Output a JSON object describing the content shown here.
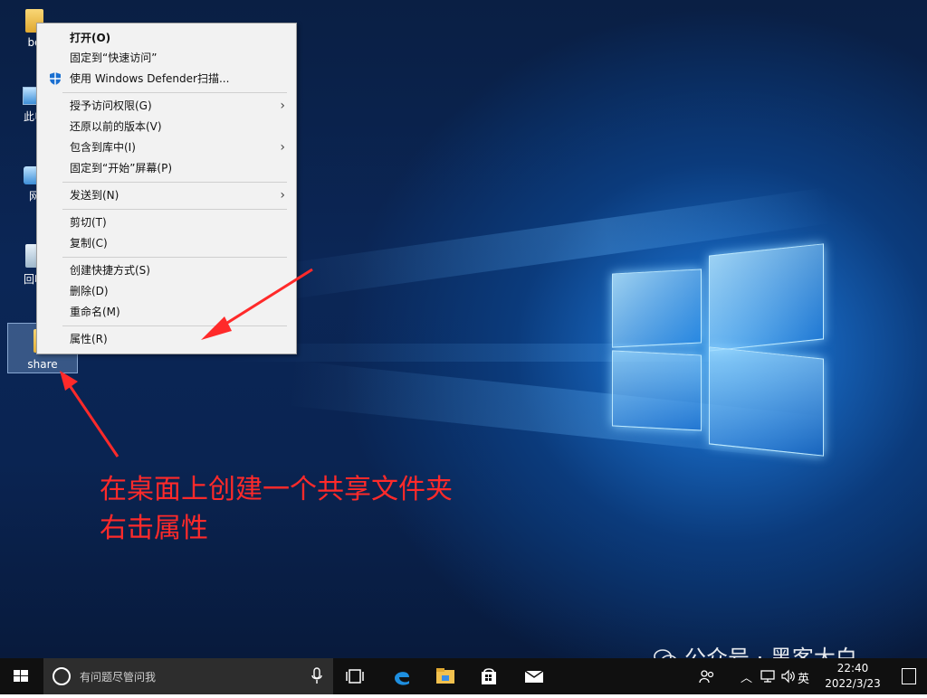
{
  "desktop": {
    "icons": [
      {
        "label": "bo"
      },
      {
        "label": "此电"
      },
      {
        "label": "网"
      },
      {
        "label": "回收"
      }
    ],
    "share_folder": {
      "label": "share"
    }
  },
  "context_menu": {
    "items": [
      {
        "label": "打开(O)"
      },
      {
        "label": "固定到“快速访问”"
      },
      {
        "label": "使用 Windows Defender扫描..."
      },
      {
        "label": "授予访问权限(G)"
      },
      {
        "label": "还原以前的版本(V)"
      },
      {
        "label": "包含到库中(I)"
      },
      {
        "label": "固定到“开始”屏幕(P)"
      },
      {
        "label": "发送到(N)"
      },
      {
        "label": "剪切(T)"
      },
      {
        "label": "复制(C)"
      },
      {
        "label": "创建快捷方式(S)"
      },
      {
        "label": "删除(D)"
      },
      {
        "label": "重命名(M)"
      },
      {
        "label": "属性(R)"
      }
    ]
  },
  "annotation": {
    "line1": "在桌面上创建一个共享文件夹",
    "line2": "右击属性",
    "color": "#ff2a2a"
  },
  "watermark": {
    "text": "公众号 · 黑客大白"
  },
  "taskbar": {
    "search_placeholder": "有问题尽管问我",
    "language": "英",
    "time": "22:40",
    "date": "2022/3/23",
    "icons": [
      "task-view-icon",
      "edge-icon",
      "file-explorer-icon",
      "store-icon",
      "mail-icon"
    ]
  }
}
